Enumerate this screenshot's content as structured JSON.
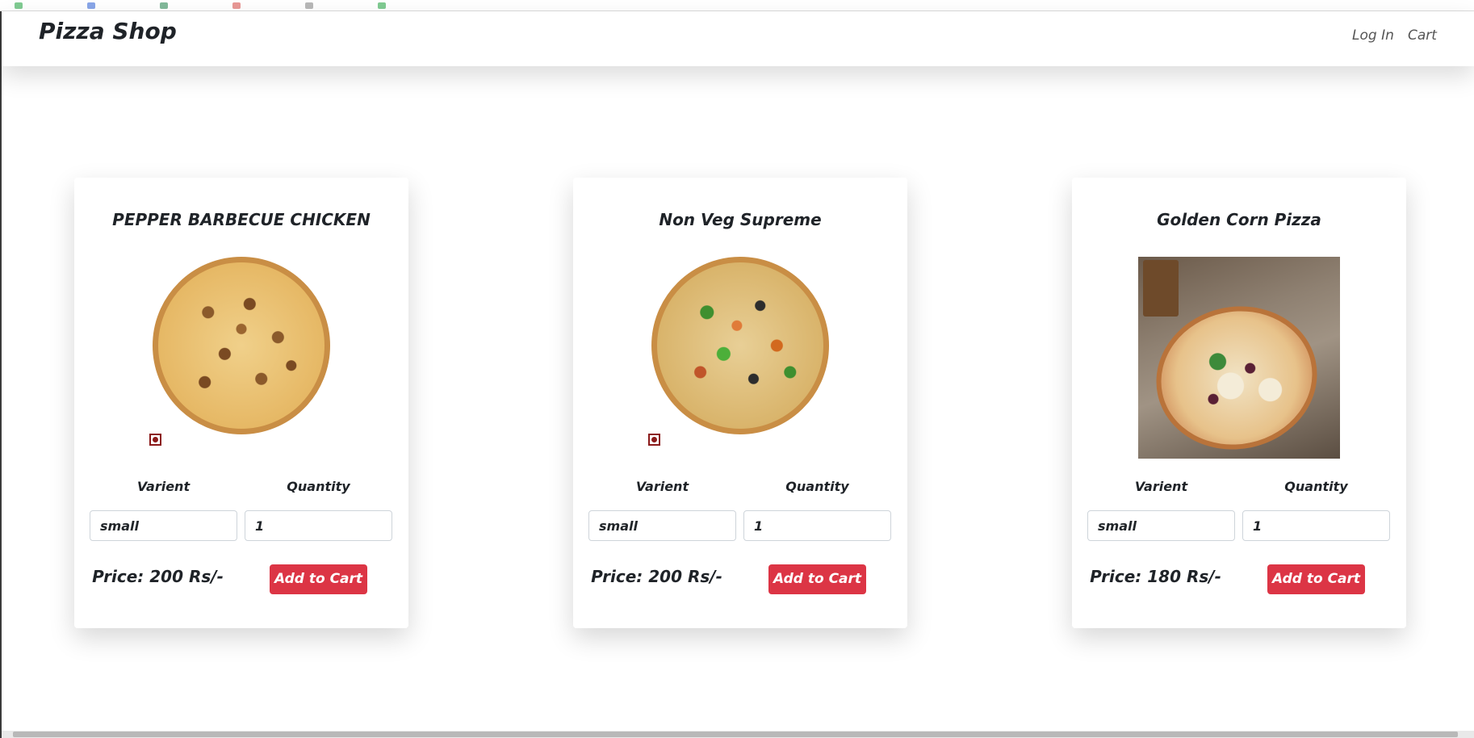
{
  "navbar": {
    "brand": "Pizza Shop",
    "login_label": "Log In",
    "cart_label": "Cart"
  },
  "pizzas": [
    {
      "name": "PEPPER BARBECUE CHICKEN",
      "image_icon": "pizza-bbq-chicken-image",
      "nonveg_mark": true,
      "varient_label": "Varient",
      "quantity_label": "Quantity",
      "varient_value": "small",
      "quantity_value": "1",
      "price": "Price: 200 Rs/-",
      "add_label": "Add to Cart"
    },
    {
      "name": "Non Veg Supreme",
      "image_icon": "pizza-nonveg-supreme-image",
      "nonveg_mark": true,
      "varient_label": "Varient",
      "quantity_label": "Quantity",
      "varient_value": "small",
      "quantity_value": "1",
      "price": "Price: 200 Rs/-",
      "add_label": "Add to Cart"
    },
    {
      "name": "Golden Corn Pizza",
      "image_icon": "pizza-golden-corn-photo",
      "nonveg_mark": false,
      "varient_label": "Varient",
      "quantity_label": "Quantity",
      "varient_value": "small",
      "quantity_value": "1",
      "price": "Price: 180 Rs/-",
      "add_label": "Add to Cart"
    }
  ],
  "colors": {
    "accent_button": "#dc3545",
    "nonveg_mark": "#8b1a1a"
  }
}
